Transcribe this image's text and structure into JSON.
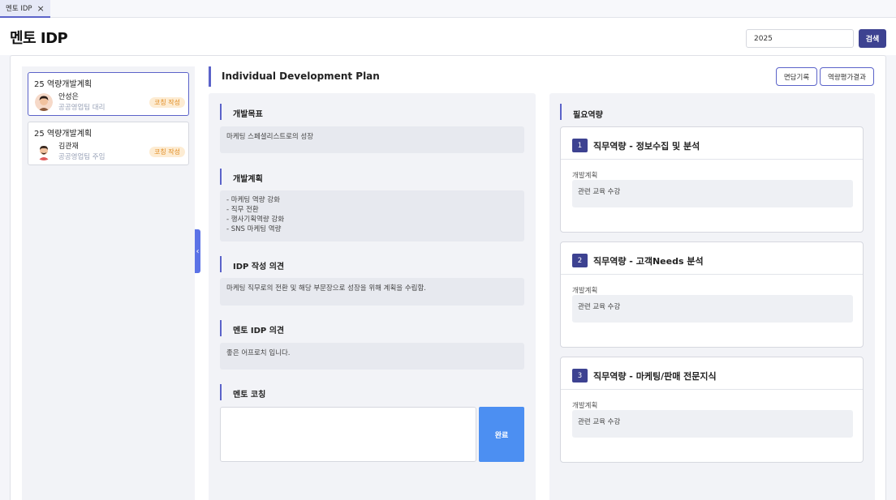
{
  "tabs": [
    {
      "label": "멘토 IDP"
    }
  ],
  "header": {
    "title": "멘토 IDP",
    "year_value": "2025",
    "search_label": "검색"
  },
  "list": [
    {
      "title": "25 역량개발계획",
      "name": "안성은",
      "dept": "공공영업팀 대리",
      "status": "코칭 작성",
      "active": true
    },
    {
      "title": "25 역량개발계획",
      "name": "김관재",
      "dept": "공공영업팀 주임",
      "status": "코칭 작성",
      "active": false
    }
  ],
  "detail": {
    "title": "Individual Development Plan",
    "btn_interview": "면담기록",
    "btn_eval": "역량평가결과",
    "sections": {
      "goal": {
        "label": "개발목표",
        "text": "마케팅 스페셜리스트로의 성장"
      },
      "plan": {
        "label": "개발계획",
        "lines": [
          "- 마케팅 역량 강화",
          "- 직무 전환",
          "- 행사기획역량 강화",
          "- SNS 마케팅 역량"
        ]
      },
      "opinion": {
        "label": "IDP 작성 의견",
        "text": "마케팅 직무로의 전환 및 해당 부문장으로 성장을 위해 계획을 수립함."
      },
      "mentor_opinion": {
        "label": "멘토 IDP 의견",
        "text": "좋은 어프로치 입니다."
      },
      "coaching": {
        "label": "멘토 코칭",
        "value": "",
        "done_label": "완료"
      }
    }
  },
  "required": {
    "label": "필요역량",
    "items": [
      {
        "num": "1",
        "title": "직무역량 - 정보수집 및 분석",
        "plan_label": "개발계획",
        "plan": "관련 교육 수강"
      },
      {
        "num": "2",
        "title": "직무역량 - 고객Needs 분석",
        "plan_label": "개발계획",
        "plan": "관련 교육 수강"
      },
      {
        "num": "3",
        "title": "직무역량 - 마케팅/판매 전문지식",
        "plan_label": "개발계획",
        "plan": "관련 교육 수강"
      }
    ]
  },
  "colors": {
    "accent": "#5b63c9",
    "primary_dark": "#3d4291",
    "done_button": "#4c8ff2",
    "badge_bg": "#fdecd3",
    "badge_text": "#e08a1e"
  }
}
